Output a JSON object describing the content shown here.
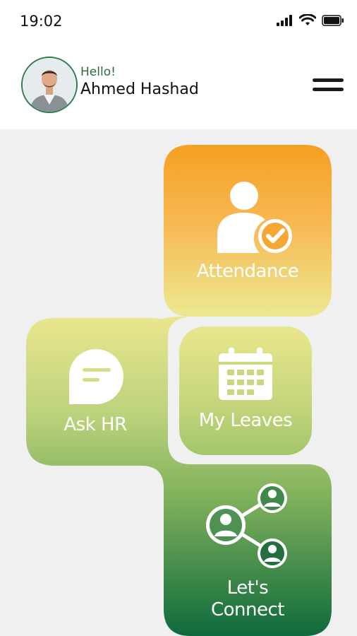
{
  "status_bar": {
    "time": "19:02"
  },
  "header": {
    "greeting": "Hello!",
    "user_name": "Ahmed Hashad"
  },
  "tiles": {
    "attendance": {
      "label": "Attendance"
    },
    "ask_hr": {
      "label": "Ask HR"
    },
    "my_leaves": {
      "label": "My Leaves"
    },
    "lets_connect": {
      "label_line1": "Let's",
      "label_line2": "Connect"
    }
  },
  "colors": {
    "orange": "#f5a022",
    "yellow": "#ece78e",
    "green_light": "#8fbd66",
    "green_dark": "#0e6a3c",
    "brand_green": "#2e6b3a"
  }
}
